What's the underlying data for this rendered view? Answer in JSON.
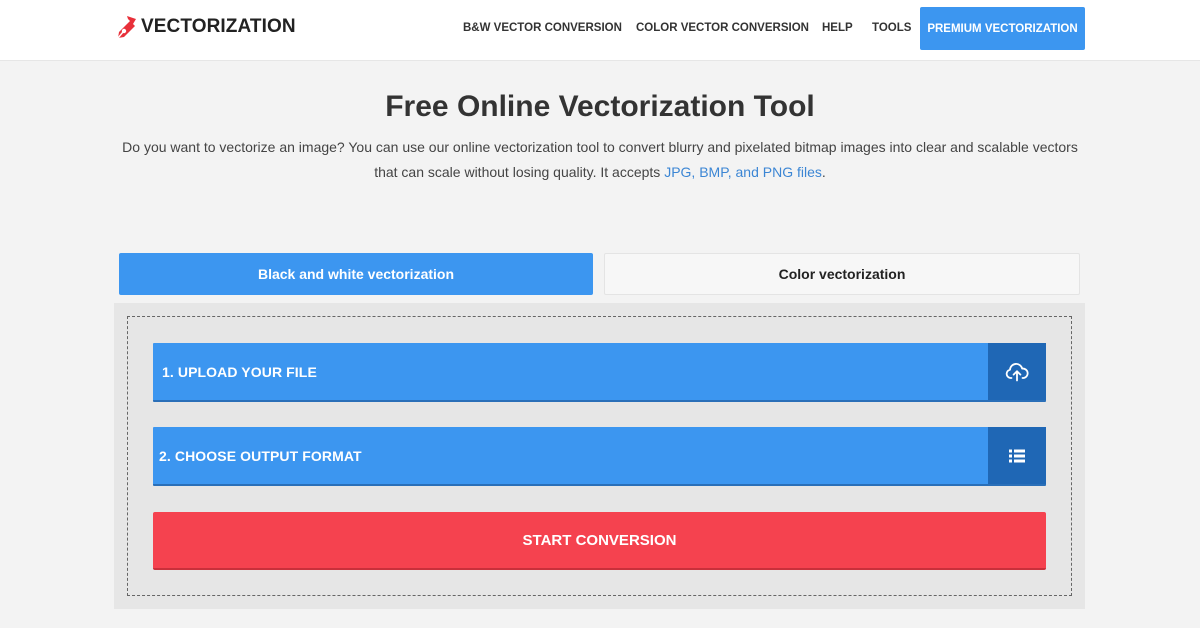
{
  "header": {
    "logo_text": "VECTORIZATION",
    "logo_icon": "pen-nib-icon",
    "nav": {
      "bw": "B&W VECTOR CONVERSION",
      "color": "COLOR VECTOR CONVERSION",
      "help": "HELP",
      "tools": "TOOLS",
      "premium": "PREMIUM VECTORIZATION"
    }
  },
  "main": {
    "title": "Free Online Vectorization Tool",
    "intro_text": "Do you want to vectorize an image? You can use our online vectorization tool to convert blurry and pixelated bitmap images into clear and scalable vectors that can scale without losing quality. It accepts ",
    "intro_link": "JPG, BMP, and PNG files",
    "intro_end": "."
  },
  "tabs": {
    "bw": "Black and white vectorization",
    "color": "Color vectorization",
    "active": "bw"
  },
  "converter": {
    "step1_label": "1. UPLOAD YOUR FILE",
    "step1_icon": "cloud-upload-icon",
    "step2_label": "2. CHOOSE OUTPUT FORMAT",
    "step2_icon": "list-icon",
    "start_label": "START CONVERSION"
  },
  "colors": {
    "accent_blue": "#3c96f0",
    "dark_blue": "#1f67b5",
    "start_red": "#f5424f",
    "link_blue": "#3c86d4"
  }
}
